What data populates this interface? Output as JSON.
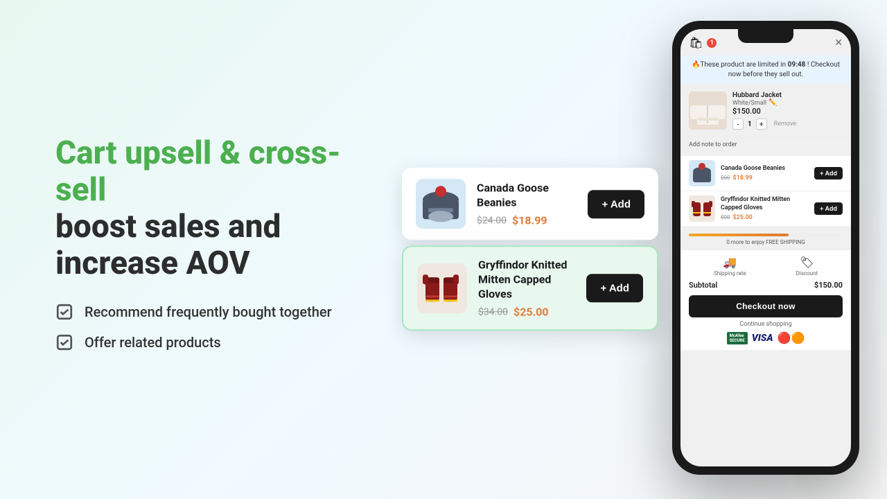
{
  "headline": {
    "green_part": "Cart upsell & cross-sell",
    "dark_part1": "boost sales and",
    "dark_part2": "increase AOV"
  },
  "features": [
    {
      "id": "feature-1",
      "text": "Recommend frequently bought together"
    },
    {
      "id": "feature-2",
      "text": "Offer related products"
    }
  ],
  "phone": {
    "cart_badge": "1",
    "close_label": "✕",
    "urgency_text": "🔥These product are limited in",
    "urgency_time": "09:48",
    "urgency_suffix": "! Checkout now before they sell out.",
    "item": {
      "name": "Hubbard Jacket",
      "variant": "White/Small",
      "price": "$150.00",
      "qty": "1",
      "remove_label": "Remove"
    },
    "add_note_label": "Add note to order",
    "upsell_items": [
      {
        "name": "Canada Goose Beanies",
        "old_price": "$00",
        "new_price": "$18.99",
        "add_label": "+ Add"
      },
      {
        "name": "Gryffindor Knitted Mitten Capped Gloves",
        "old_price": "$00",
        "new_price": "$25.00",
        "add_label": "+ Add"
      }
    ],
    "subtotal_label": "Subtotal",
    "subtotal_value": "$150.00",
    "shipping_label": "Shipping rate",
    "discount_label": "Discount",
    "checkout_label": "Checkout now",
    "continue_label": "Continue shopping"
  },
  "upsell_cards": [
    {
      "name": "Canada Goose Beanies",
      "old_price": "$24.00",
      "new_price": "$18.99",
      "add_label": "+ Add",
      "selected": false
    },
    {
      "name": "Gryffindor Knitted Mitten Capped Gloves",
      "old_price": "$34.00",
      "new_price": "$25.00",
      "add_label": "+ Add",
      "selected": true
    }
  ],
  "colors": {
    "green": "#4caf50",
    "dark": "#2d2d2d",
    "orange": "#e07b39",
    "checkout_bg": "#1a1a1a"
  }
}
